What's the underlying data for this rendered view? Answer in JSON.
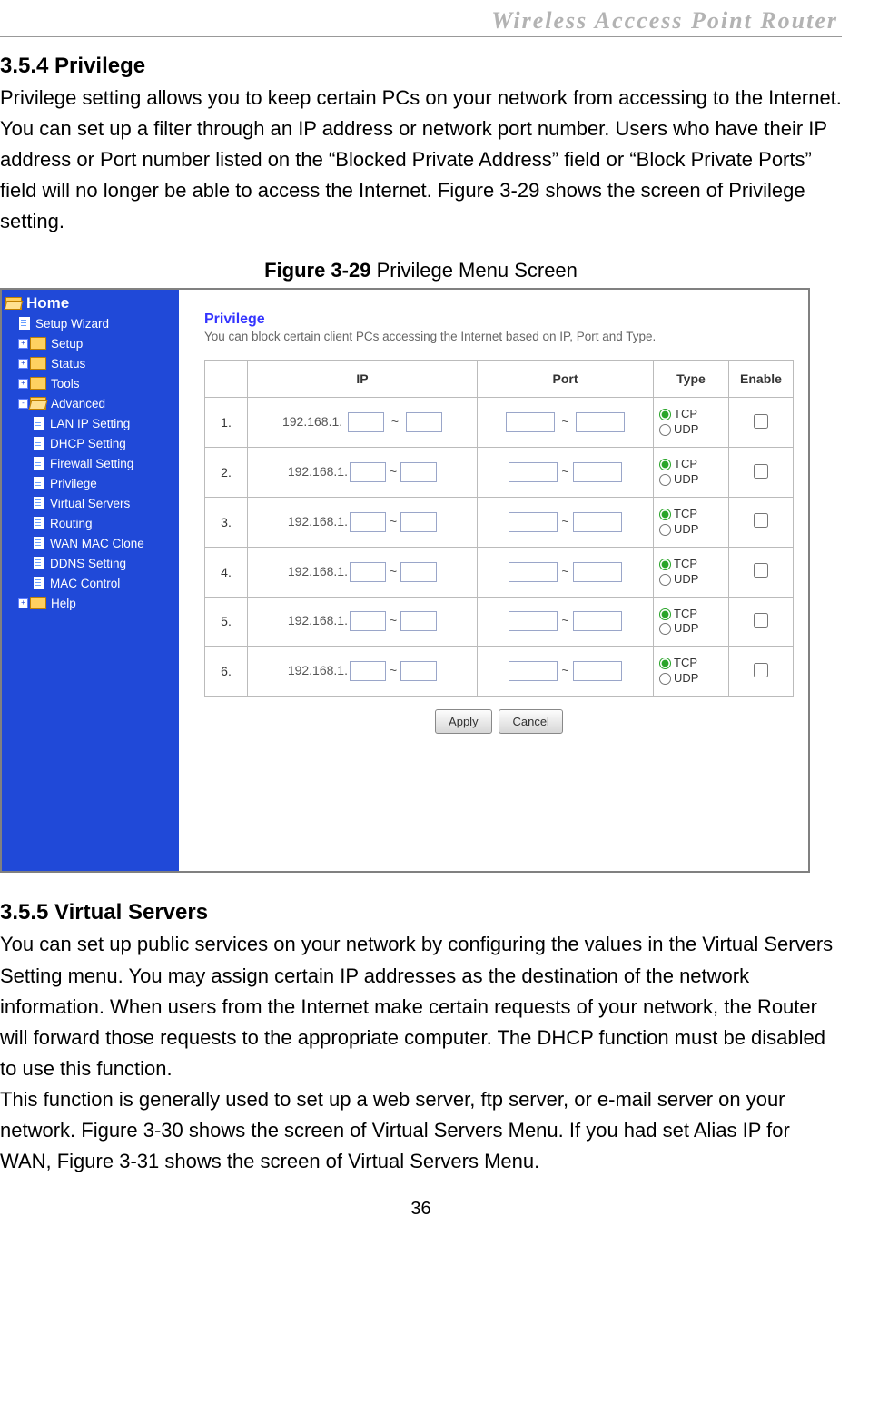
{
  "header": {
    "title": "Wireless  Acccess  Point  Router"
  },
  "section1": {
    "heading": "3.5.4 Privilege",
    "body": "Privilege setting allows you to keep certain PCs on your network from accessing to the Internet. You can set up a filter through an IP address or network port number. Users who have their IP address or Port number listed on the “Blocked Private Address” field or “Block Private Ports” field will no longer be able to access the Internet. Figure 3-29 shows the screen of Privilege setting."
  },
  "figure": {
    "caption_bold": "Figure 3-29",
    "caption_rest": " Privilege Menu Screen"
  },
  "sidebar": {
    "root": "Home",
    "top_items": [
      {
        "label": "Setup Wizard",
        "type": "page"
      },
      {
        "label": "Setup",
        "type": "folder",
        "box": "+"
      },
      {
        "label": "Status",
        "type": "folder",
        "box": "+"
      },
      {
        "label": "Tools",
        "type": "folder",
        "box": "+"
      },
      {
        "label": "Advanced",
        "type": "folder",
        "box": "-",
        "open": true
      }
    ],
    "advanced_items": [
      "LAN IP Setting",
      "DHCP Setting",
      "Firewall Setting",
      "Privilege",
      "Virtual Servers",
      "Routing",
      "WAN MAC Clone",
      "DDNS Setting",
      "MAC Control"
    ],
    "bottom_items": [
      {
        "label": "Help",
        "type": "folder",
        "box": "+"
      }
    ]
  },
  "pane": {
    "title": "Privilege",
    "subtitle": "You can block certain client PCs accessing the Internet based on IP, Port and Type.",
    "headers": {
      "ip": "IP",
      "port": "Port",
      "type": "Type",
      "enable": "Enable"
    },
    "ip_prefix": "192.168.1.",
    "tilde": "~",
    "type_tcp": "TCP",
    "type_udp": "UDP",
    "rows": [
      "1.",
      "2.",
      "3.",
      "4.",
      "5.",
      "6."
    ],
    "apply": "Apply",
    "cancel": "Cancel"
  },
  "section2": {
    "heading": "3.5.5 Virtual Servers",
    "body1": "You can set up public services on your network by configuring the values in the Virtual Servers Setting menu. You may assign certain IP addresses as the destination of the network information. When users from the Internet make certain requests of your network, the Router will forward those requests to the appropriate computer. The DHCP function must be disabled to use this function.",
    "body2": "This function is generally used to set up a web server, ftp server, or e-mail server on your network. Figure 3-30 shows the screen of Virtual Servers Menu. If you had set Alias IP for WAN, Figure 3-31 shows the screen of Virtual Servers Menu."
  },
  "page_number": "36"
}
